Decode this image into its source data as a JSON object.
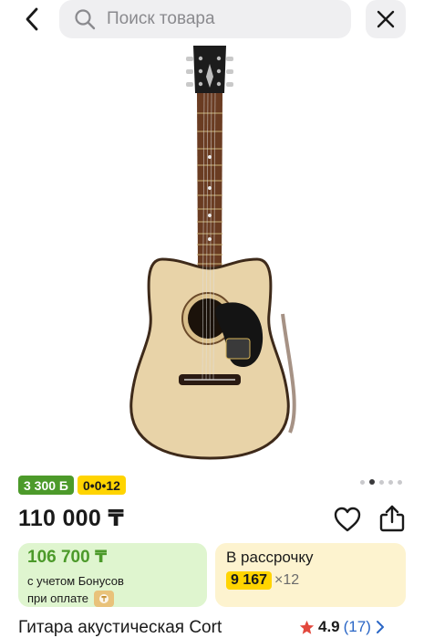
{
  "search": {
    "placeholder": "Поиск товара"
  },
  "badges": {
    "bonus": "3 300 Б",
    "installment": "0•0•12"
  },
  "carousel": {
    "total": 5,
    "active_index": 1
  },
  "product": {
    "price": "110 000 ₸",
    "title": "Гитара акустическая Cort"
  },
  "bonus_card": {
    "amount": "106 700 ₸",
    "line1": "с учетом Бонусов",
    "line2": "при оплате"
  },
  "installment_card": {
    "label": "В рассрочку",
    "monthly": "9 167",
    "months": "×12"
  },
  "rating": {
    "value": "4.9",
    "count": "(17)"
  },
  "colors": {
    "bonus_green": "#4c9a2a",
    "installment_yellow": "#ffd400",
    "bonus_card_bg": "#dff5cf",
    "installment_card_bg": "#fdf3cf",
    "star": "#e2483d",
    "link_blue": "#2a66c6"
  },
  "icons": [
    "back-arrow-icon",
    "search-icon",
    "close-icon",
    "heart-icon",
    "share-icon",
    "coin-icon",
    "star-icon",
    "chevron-right-icon"
  ]
}
